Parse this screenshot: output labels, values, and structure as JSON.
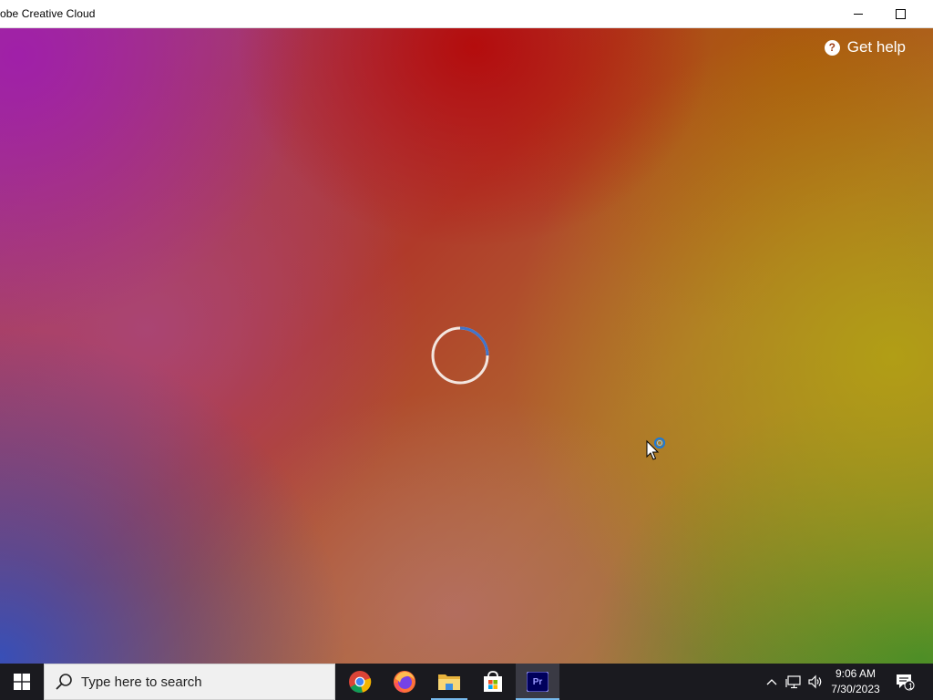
{
  "window": {
    "title": "obe Creative Cloud"
  },
  "content": {
    "help_label": "Get help",
    "help_icon": "question-circle-icon",
    "loading": "spinner-icon"
  },
  "taskbar": {
    "search_placeholder": "Type here to search",
    "apps": [
      {
        "name": "chrome-icon"
      },
      {
        "name": "firefox-icon"
      },
      {
        "name": "file-explorer-icon"
      },
      {
        "name": "microsoft-store-icon"
      },
      {
        "name": "premiere-pro-icon",
        "label": "Pr"
      }
    ],
    "clock": {
      "time": "9:06 AM",
      "date": "7/30/2023"
    },
    "notification_count": "1"
  },
  "colors": {
    "taskbar_bg": "#1a1a1f",
    "accent": "#76b9ed",
    "premiere_bg": "#00005b",
    "premiere_text": "#9999ff"
  }
}
